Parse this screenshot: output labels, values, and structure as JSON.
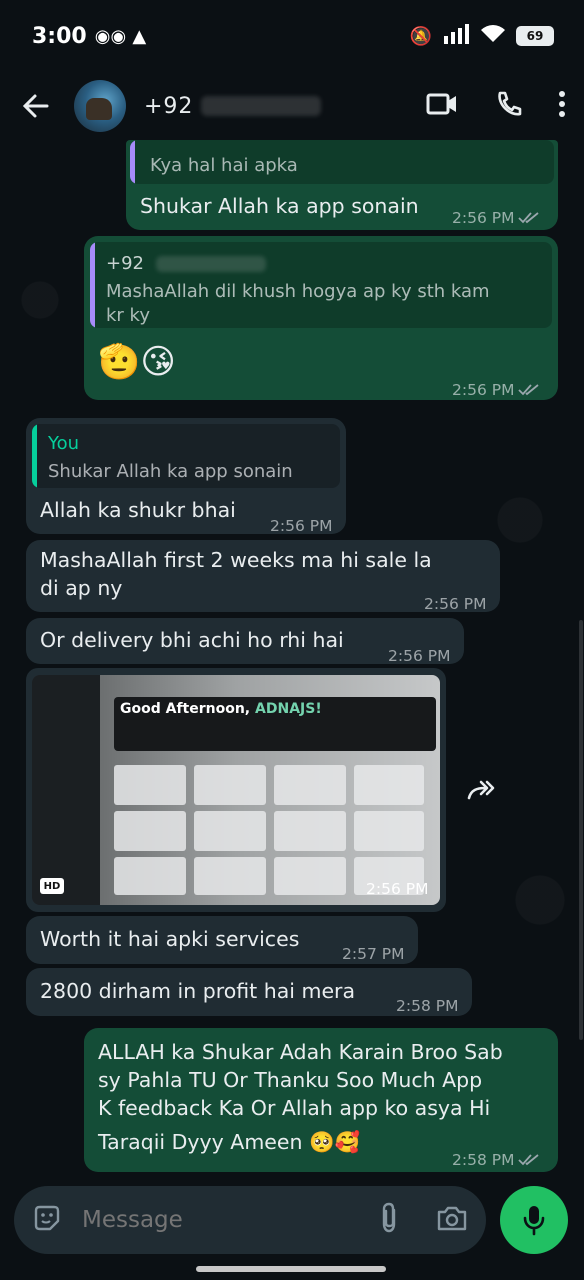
{
  "status_bar": {
    "time": "3:00",
    "battery": "69"
  },
  "header": {
    "contact_prefix": "+92"
  },
  "messages": [
    {
      "type": "out",
      "quote_text": "Kya hal hai apka",
      "text": "Shukar Allah ka app sonain",
      "time": "2:56 PM"
    },
    {
      "type": "out",
      "quote_author": "+92",
      "quote_text_1": "MashaAllah dil khush hogya ap ky sth kam",
      "quote_text_2": "kr ky",
      "emoji": "🫡😘",
      "time": "2:56 PM"
    },
    {
      "type": "in",
      "quote_author": "You",
      "quote_text": "Shukar Allah ka app sonain",
      "text": "Allah ka shukr bhai",
      "time": "2:56 PM"
    },
    {
      "type": "in",
      "text_1": "MashaAllah first 2 weeks ma hi sale la",
      "text_2": "di ap ny",
      "time": "2:56 PM"
    },
    {
      "type": "in",
      "text": "Or delivery bhi achi ho rhi hai",
      "time": "2:56 PM"
    },
    {
      "type": "in-image",
      "image_greeting": "Good Afternoon,",
      "image_name": "ADNAJS!",
      "badge": "HD",
      "time": "2:56 PM"
    },
    {
      "type": "in",
      "text": "Worth it hai apki services",
      "time": "2:57 PM"
    },
    {
      "type": "in",
      "text": "2800 dirham in profit hai mera",
      "time": "2:58 PM"
    },
    {
      "type": "out",
      "text_1": "ALLAH ka Shukar Adah Karain Broo Sab",
      "text_2": "sy Pahla TU Or Thanku Soo Much App",
      "text_3": "K feedback Ka Or Allah app ko asya Hi",
      "text_4": "Taraqii Dyyy Ameen 🥺🥰",
      "time": "2:58 PM"
    }
  ],
  "composer": {
    "placeholder": "Message"
  },
  "colors": {
    "outgoing": "#144d37",
    "incoming": "#202c33",
    "accent": "#21c063",
    "quote_bar_out": "#a78bfa",
    "quote_bar_in": "#06cf9c"
  }
}
